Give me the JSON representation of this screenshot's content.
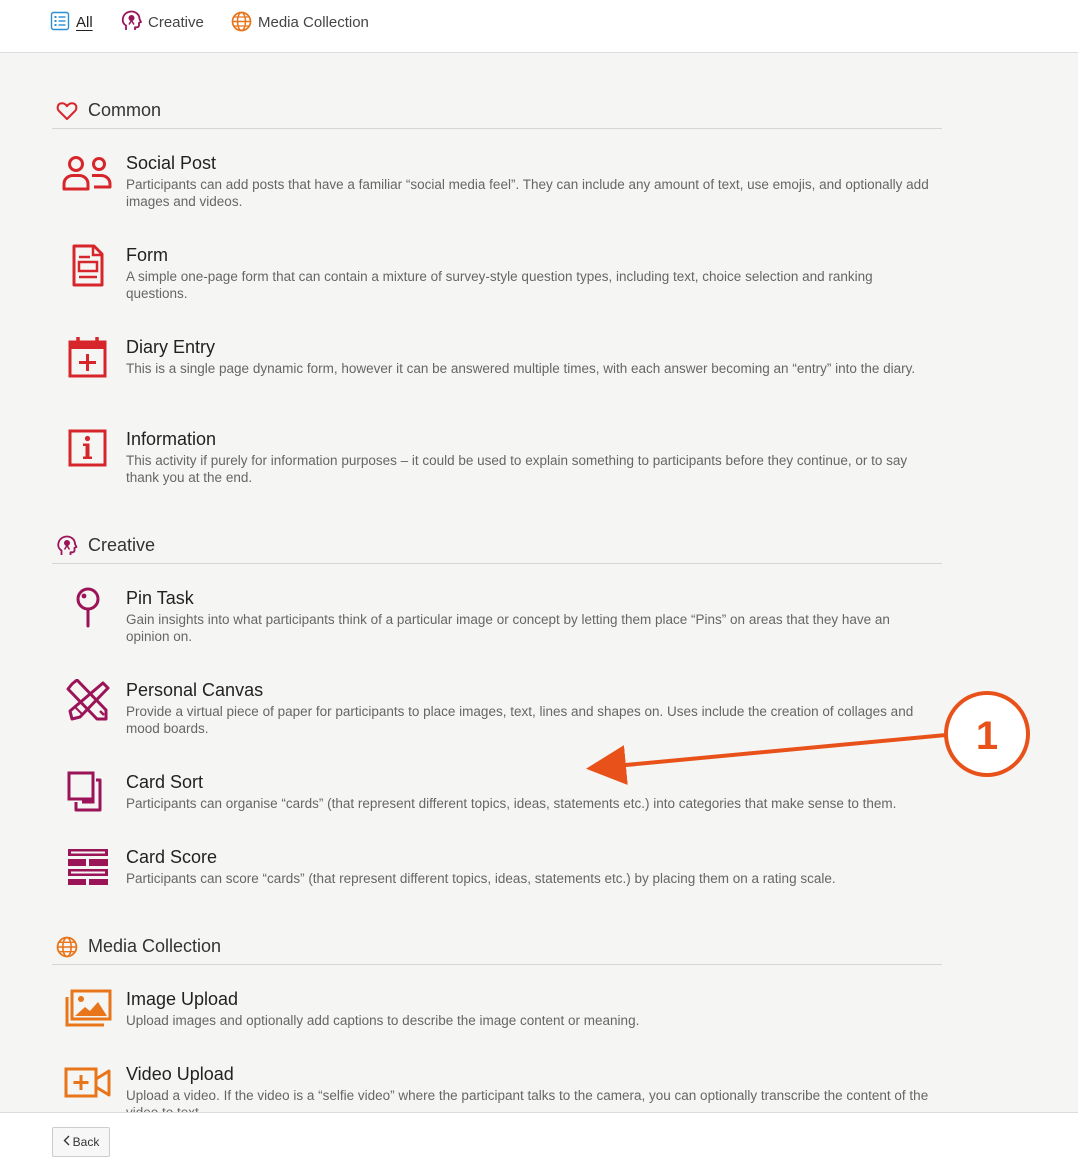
{
  "tabs": [
    {
      "label": "All",
      "icon": "list-icon",
      "active": true
    },
    {
      "label": "Creative",
      "icon": "creative-head-icon",
      "active": false
    },
    {
      "label": "Media Collection",
      "icon": "globe-icon",
      "active": false
    }
  ],
  "sections": [
    {
      "title": "Common",
      "icon": "heart-icon",
      "color": "#d7262b",
      "items": [
        {
          "title": "Social Post",
          "icon": "users-icon",
          "description": "Participants can add posts that have a familiar “social media feel”. They can include any amount of text, use emojis, and optionally add images and videos."
        },
        {
          "title": "Form",
          "icon": "form-document-icon",
          "description": "A simple one-page form that can contain a mixture of survey-style question types, including text, choice selection and ranking questions."
        },
        {
          "title": "Diary Entry",
          "icon": "calendar-plus-icon",
          "description": "This is a single page dynamic form, however it can be answered multiple times, with each answer becoming an “entry” into the diary."
        },
        {
          "title": "Information",
          "icon": "info-icon",
          "description": "This activity if purely for information purposes – it could be used to explain something to participants before they continue, or to say thank you at the end."
        }
      ]
    },
    {
      "title": "Creative",
      "icon": "creative-head-icon",
      "color": "#9c1458",
      "items": [
        {
          "title": "Pin Task",
          "icon": "pin-icon",
          "description": "Gain insights into what participants think of a particular image or concept by letting them place “Pins” on areas that they have an opinion on."
        },
        {
          "title": "Personal Canvas",
          "icon": "pencil-ruler-icon",
          "description": "Provide a virtual piece of paper for participants to place images, text, lines and shapes on. Uses include the creation of collages and mood boards."
        },
        {
          "title": "Card Sort",
          "icon": "cards-icon",
          "description": "Participants can organise “cards” (that represent different topics, ideas, statements etc.) into categories that make sense to them."
        },
        {
          "title": "Card Score",
          "icon": "card-rows-icon",
          "description": "Participants can score “cards” (that represent different topics, ideas, statements etc.) by placing them on a rating scale."
        }
      ]
    },
    {
      "title": "Media Collection",
      "icon": "globe-icon",
      "color": "#e8751a",
      "items": [
        {
          "title": "Image Upload",
          "icon": "image-upload-icon",
          "description": "Upload images and optionally add captions to describe the image content or meaning."
        },
        {
          "title": "Video Upload",
          "icon": "video-plus-icon",
          "description": "Upload a video. If the video is a “selfie video” where the participant talks to the camera, you can optionally transcribe the content of the video to text."
        }
      ]
    }
  ],
  "annotation": {
    "number": "1",
    "color": "#e8521a"
  },
  "footer": {
    "back_label": "Back"
  }
}
